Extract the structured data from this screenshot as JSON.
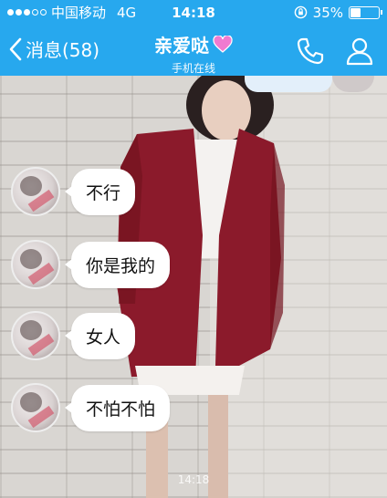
{
  "status_bar": {
    "carrier": "中国移动",
    "network": "4G",
    "time": "14:18",
    "battery": "35%",
    "battery_level": 0.35
  },
  "nav": {
    "back_label": "消息(58)",
    "title": "亲爱哒",
    "subtitle": "手机在线"
  },
  "messages": [
    {
      "text": "不行"
    },
    {
      "text": "你是我的"
    },
    {
      "text": "女人"
    },
    {
      "text": "不怕不怕"
    }
  ],
  "chat_timestamp": "14:18",
  "colors": {
    "header_blue": "#27a8ee",
    "bubble": "#ffffff",
    "cardigan": "#8b1a2b"
  }
}
